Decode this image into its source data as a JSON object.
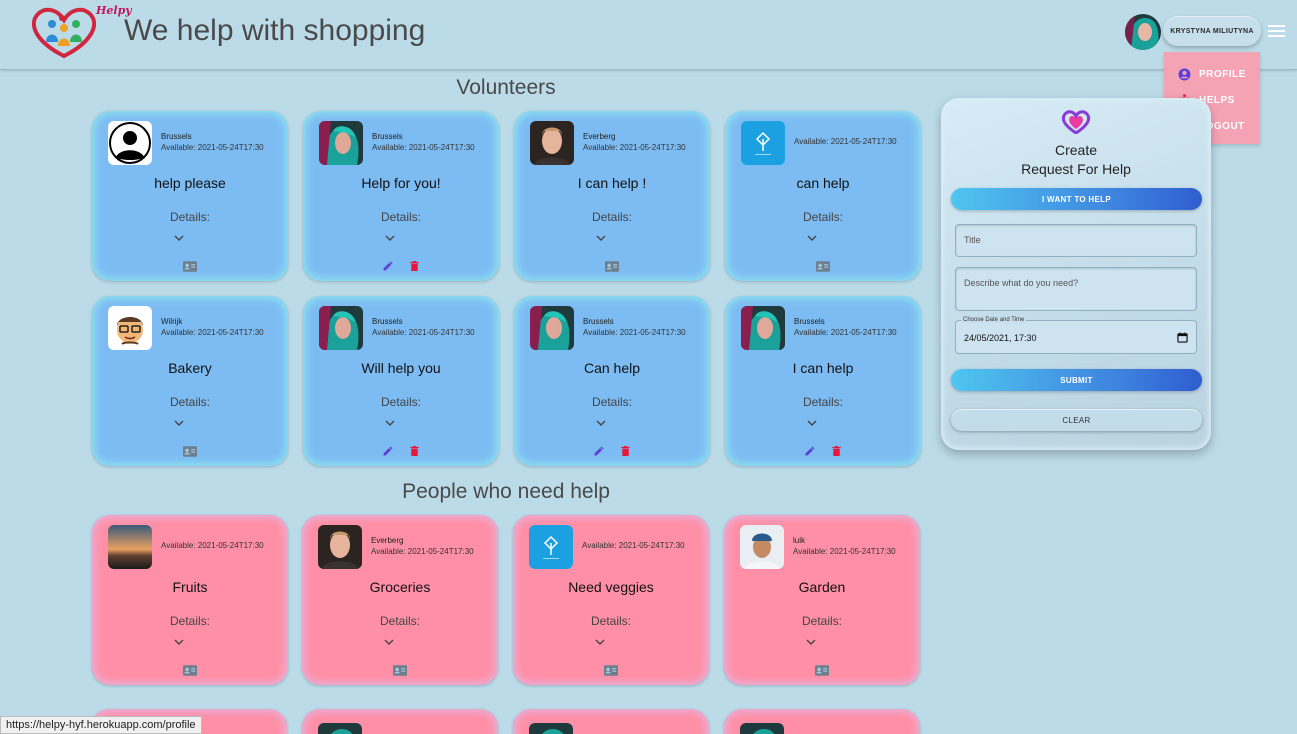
{
  "header": {
    "title": "We help with shopping",
    "logo_text": "Helpy",
    "user_name": "KRYSTYNA MILIUTYNA"
  },
  "user_menu": {
    "items": [
      {
        "label": "PROFILE",
        "icon": "account-circle-icon"
      },
      {
        "label": "HELPS",
        "icon": "person-accessibility-icon"
      },
      {
        "label": "LOGOUT",
        "icon": "logout-icon"
      }
    ]
  },
  "volunteers": {
    "heading": "Volunteers",
    "cards": [
      {
        "city": "Brussels",
        "available": "Available: 2021-05-24T17:30",
        "title": "help please",
        "details": "Details:",
        "avatar": "default-avatar",
        "owned": false
      },
      {
        "city": "Brussels",
        "available": "Available: 2021-05-24T17:30",
        "title": "Help for you!",
        "details": "Details:",
        "avatar": "teal-hair-photo",
        "owned": true
      },
      {
        "city": "Everberg",
        "available": "Available: 2021-05-24T17:30",
        "title": "I can help !",
        "details": "Details:",
        "avatar": "man-photo",
        "owned": false
      },
      {
        "city": "",
        "available": "Available: 2021-05-24T17:30",
        "title": "can help",
        "details": "Details:",
        "avatar": "blue-logo",
        "owned": false
      },
      {
        "city": "Wilrijk",
        "available": "Available: 2021-05-24T17:30",
        "title": "Bakery",
        "details": "Details:",
        "avatar": "emoji-glasses",
        "owned": false
      },
      {
        "city": "Brussels",
        "available": "Available: 2021-05-24T17:30",
        "title": "Will help you",
        "details": "Details:",
        "avatar": "teal-hair-photo",
        "owned": true
      },
      {
        "city": "Brussels",
        "available": "Available: 2021-05-24T17:30",
        "title": "Can help",
        "details": "Details:",
        "avatar": "teal-hair-photo",
        "owned": true
      },
      {
        "city": "Brussels",
        "available": "Available: 2021-05-24T17:30",
        "title": "I can help",
        "details": "Details:",
        "avatar": "teal-hair-photo",
        "owned": true
      }
    ]
  },
  "needers": {
    "heading": "People who need help",
    "cards": [
      {
        "city": "",
        "available": "Available: 2021-05-24T17:30",
        "title": "Fruits",
        "details": "Details:",
        "avatar": "sunset-photo"
      },
      {
        "city": "Everberg",
        "available": "Available: 2021-05-24T17:30",
        "title": "Groceries",
        "details": "Details:",
        "avatar": "man-photo"
      },
      {
        "city": "",
        "available": "Available: 2021-05-24T17:30",
        "title": "Need veggies",
        "details": "Details:",
        "avatar": "blue-logo"
      },
      {
        "city": "luik",
        "available": "Available: 2021-05-24T17:30",
        "title": "Garden",
        "details": "Details:",
        "avatar": "cap-man-photo"
      }
    ]
  },
  "request_form": {
    "title_line1": "Create",
    "title_line2": "Request For Help",
    "toggle_label": "I WANT TO HELP",
    "title_placeholder": "Title",
    "description_placeholder": "Describe what do you need?",
    "date_label": "Choose Date and Time",
    "date_value": "24/05/2021, 17:30",
    "submit_label": "SUBMIT",
    "clear_label": "CLEAR"
  },
  "status_bar": {
    "url": "https://helpy-hyf.herokuapp.com/profile"
  },
  "colors": {
    "background": "#bcdbe8",
    "volunteer_card": "#7dbcf3",
    "need_card": "#ff8fa6",
    "menu_bg": "#f4a3b5",
    "accent_blue": "#3d7fde",
    "delete_red": "#e8173a",
    "edit_purple": "#5b3fd6"
  }
}
